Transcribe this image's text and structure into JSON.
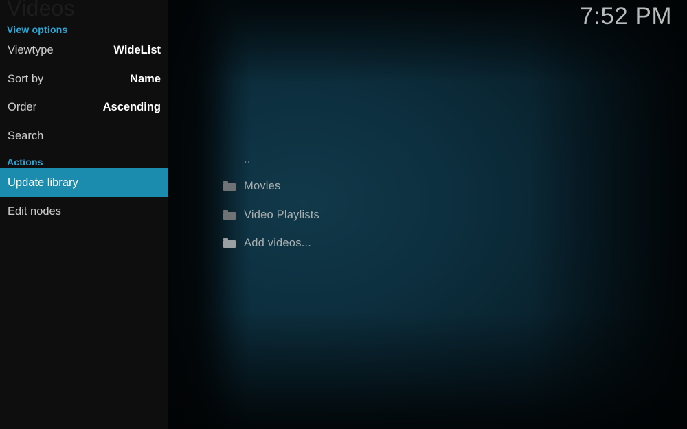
{
  "window": {
    "section_watermark": "Videos",
    "clock": "7:52 PM"
  },
  "colors": {
    "accent": "#2ba5d6",
    "selection": "#1b8cae",
    "sidebar_bg": "#0e0e0e",
    "content_glow": "#11394a",
    "label_text": "#cccccc",
    "value_text": "#ffffff",
    "list_text": "#a9afb1"
  },
  "sidebar": {
    "groups": [
      {
        "id": "view_options",
        "label": "View options"
      },
      {
        "id": "actions",
        "label": "Actions"
      }
    ],
    "rows": [
      {
        "id": "viewtype",
        "label": "Viewtype",
        "value": "WideList",
        "selected": false
      },
      {
        "id": "sortby",
        "label": "Sort by",
        "value": "Name",
        "selected": false
      },
      {
        "id": "order",
        "label": "Order",
        "value": "Ascending",
        "selected": false
      },
      {
        "id": "search",
        "label": "Search",
        "value": "",
        "selected": false
      },
      {
        "id": "update",
        "label": "Update library",
        "value": "",
        "selected": true
      },
      {
        "id": "editnodes",
        "label": "Edit nodes",
        "value": "",
        "selected": false
      }
    ]
  },
  "content": {
    "items": [
      {
        "id": "parent",
        "label": "..",
        "icon": "none"
      },
      {
        "id": "movies",
        "label": "Movies",
        "icon": "folder-icon"
      },
      {
        "id": "video_playlists",
        "label": "Video Playlists",
        "icon": "folder-icon"
      },
      {
        "id": "add_videos",
        "label": "Add videos...",
        "icon": "folder-icon"
      }
    ]
  }
}
